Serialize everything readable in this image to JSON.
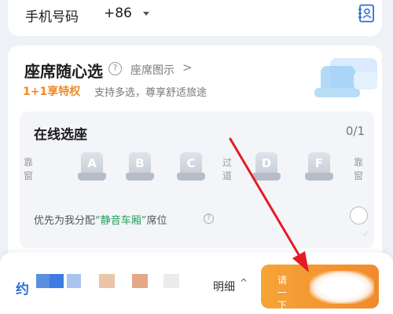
{
  "phone": {
    "label": "手机号码",
    "country_code": "+86"
  },
  "seat_selection": {
    "title": "座席随心选",
    "help_glyph": "?",
    "seat_map_link": "座席图示",
    "chevron": ">",
    "privilege": "1+1享特权",
    "privilege_desc": "支持多选，尊享舒适旅途",
    "online_panel": {
      "title": "在线选座",
      "count": "0/1",
      "window_label": "靠窗",
      "aisle_label": "过道",
      "seats": [
        "A",
        "B",
        "C",
        "D",
        "F"
      ],
      "assign_prefix": "优先为我分配",
      "assign_highlight": "“静音车厢”",
      "assign_suffix": "席位",
      "assign_help_glyph": "?"
    }
  },
  "bottom_bar": {
    "about_text": "约",
    "detail_label": "明细",
    "up_glyph": "^",
    "submit_text": "请一下"
  },
  "colors": {
    "accent_orange": "#f18a2c",
    "accent_blue": "#2a6fd6",
    "quiet_green": "#22a05a",
    "arrow_red": "#e31c24"
  }
}
